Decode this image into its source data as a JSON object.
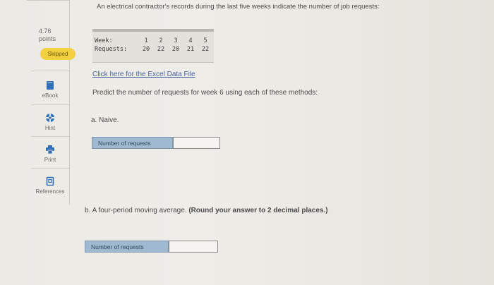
{
  "question": {
    "intro": "An electrical contractor's records during the last five weeks indicate the number of job requests:",
    "table": {
      "week_label": "Week:",
      "requests_label": "Requests:",
      "weeks": [
        "1",
        "2",
        "3",
        "4",
        "5"
      ],
      "requests": [
        "20",
        "22",
        "20",
        "21",
        "22"
      ]
    },
    "excel_link": "Click here for the Excel Data File",
    "instruction": "Predict the number of requests for week 6 using each of these methods:",
    "part_a": {
      "label": "a. Naive.",
      "answer_label": "Number of requests",
      "answer_value": ""
    },
    "part_b": {
      "label": "b. A four-period moving average.",
      "note": "(Round your answer to 2 decimal places.)",
      "answer_label": "Number of requests",
      "answer_value": ""
    }
  },
  "sidebar": {
    "points_value": "4.76",
    "points_label": "points",
    "status": "Skipped",
    "tools": [
      {
        "label": "eBook",
        "icon": "book-icon"
      },
      {
        "label": "Hint",
        "icon": "lifebuoy-icon"
      },
      {
        "label": "Print",
        "icon": "printer-icon"
      },
      {
        "label": "References",
        "icon": "document-icon"
      }
    ]
  },
  "colors": {
    "badge": "#f2d03f",
    "answer_label_bg": "#9fbad0",
    "link": "#4a62a0"
  }
}
